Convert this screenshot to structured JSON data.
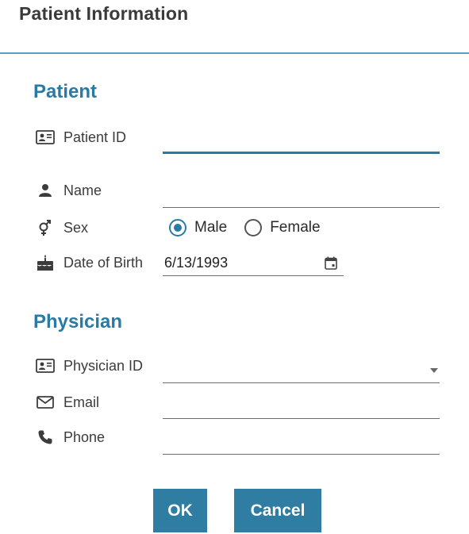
{
  "dialog": {
    "title": "Patient Information"
  },
  "patient_section": {
    "heading": "Patient",
    "patient_id": {
      "label": "Patient ID",
      "value": "",
      "icon": "id-card-icon"
    },
    "name": {
      "label": "Name",
      "value": "",
      "icon": "person-icon"
    },
    "sex": {
      "label": "Sex",
      "icon": "gender-icon",
      "options": [
        {
          "label": "Male",
          "checked": true
        },
        {
          "label": "Female",
          "checked": false
        }
      ]
    },
    "date_of_birth": {
      "label": "Date of Birth",
      "value": "6/13/1993",
      "icon": "birthday-cake-icon"
    }
  },
  "physician_section": {
    "heading": "Physician",
    "physician_id": {
      "label": "Physician ID",
      "value": "",
      "icon": "id-card-icon"
    },
    "email": {
      "label": "Email",
      "value": "",
      "icon": "envelope-icon"
    },
    "phone": {
      "label": "Phone",
      "value": "",
      "icon": "phone-icon"
    }
  },
  "buttons": {
    "ok_label": "OK",
    "cancel_label": "Cancel"
  },
  "colors": {
    "accent": "#2a7ba4",
    "button_bg": "#2f7da3",
    "divider": "#5e9fb7"
  }
}
